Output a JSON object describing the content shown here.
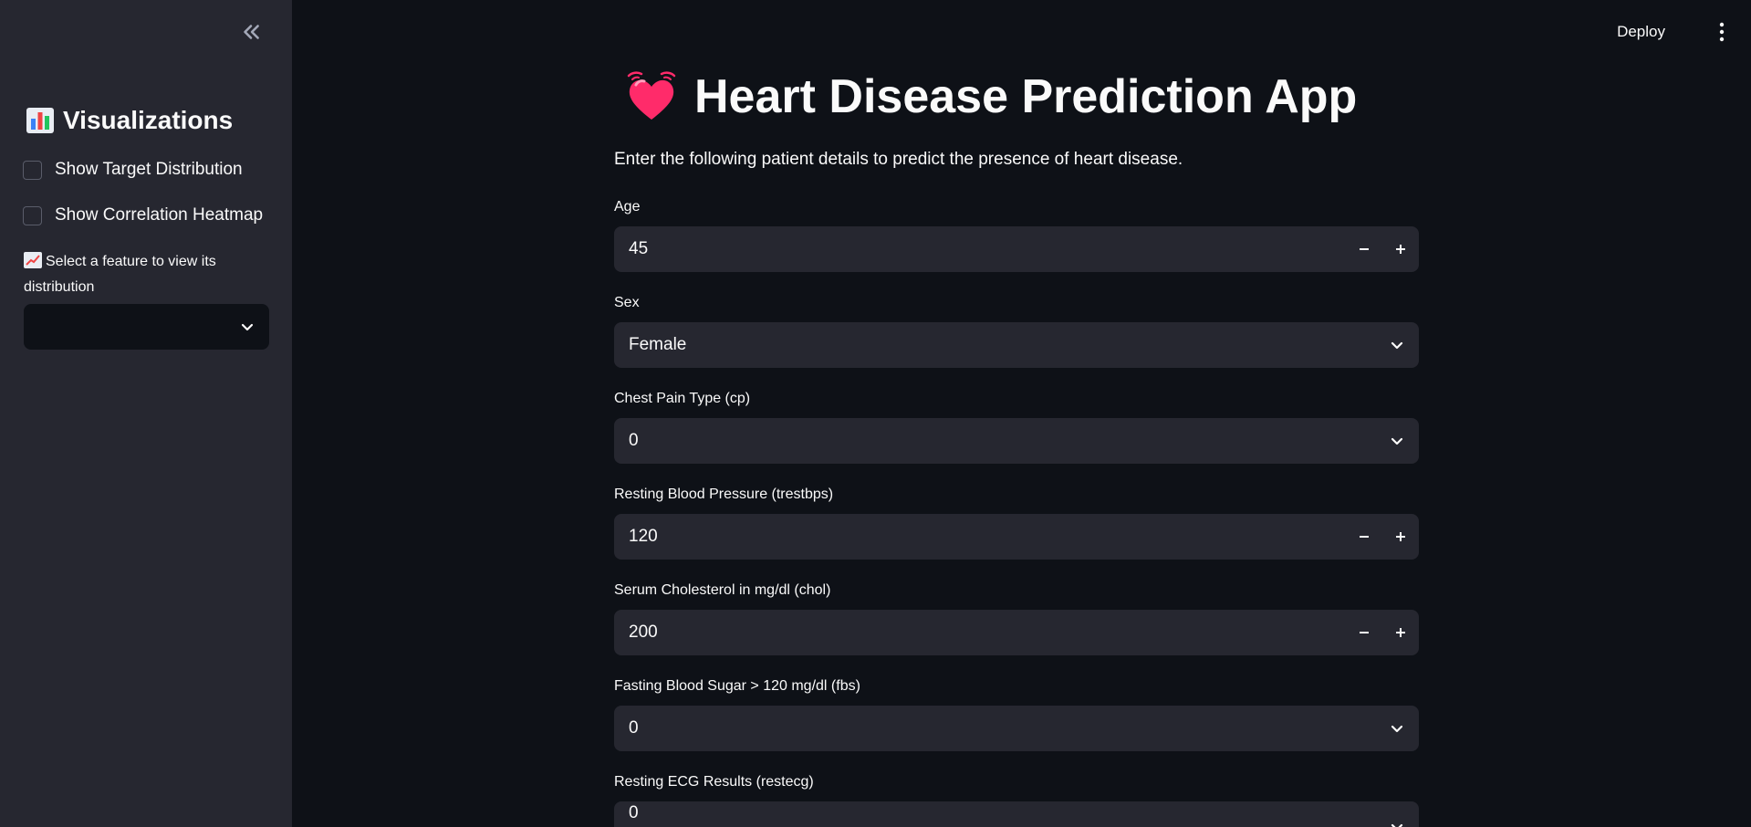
{
  "sidebar": {
    "title": "Visualizations",
    "checkboxes": [
      {
        "label": "Show Target Distribution",
        "checked": false
      },
      {
        "label": "Show Correlation Heatmap",
        "checked": false
      }
    ],
    "feature_select": {
      "label": "Select a feature to view its distribution",
      "value": ""
    }
  },
  "header": {
    "deploy_label": "Deploy"
  },
  "main": {
    "title": "Heart Disease Prediction App",
    "subtitle": "Enter the following patient details to predict the presence of heart disease.",
    "fields": [
      {
        "label": "Age",
        "type": "number",
        "value": "45"
      },
      {
        "label": "Sex",
        "type": "select",
        "value": "Female"
      },
      {
        "label": "Chest Pain Type (cp)",
        "type": "select",
        "value": "0"
      },
      {
        "label": "Resting Blood Pressure (trestbps)",
        "type": "number",
        "value": "120"
      },
      {
        "label": "Serum Cholesterol in mg/dl (chol)",
        "type": "number",
        "value": "200"
      },
      {
        "label": "Fasting Blood Sugar > 120 mg/dl (fbs)",
        "type": "select",
        "value": "0"
      },
      {
        "label": "Resting ECG Results (restecg)",
        "type": "select",
        "value": "0"
      }
    ]
  },
  "colors": {
    "background": "#0e1117",
    "sidebar": "#262730",
    "input": "#262730",
    "text": "#fafafa",
    "accent_heart": "#ff2b6a"
  }
}
